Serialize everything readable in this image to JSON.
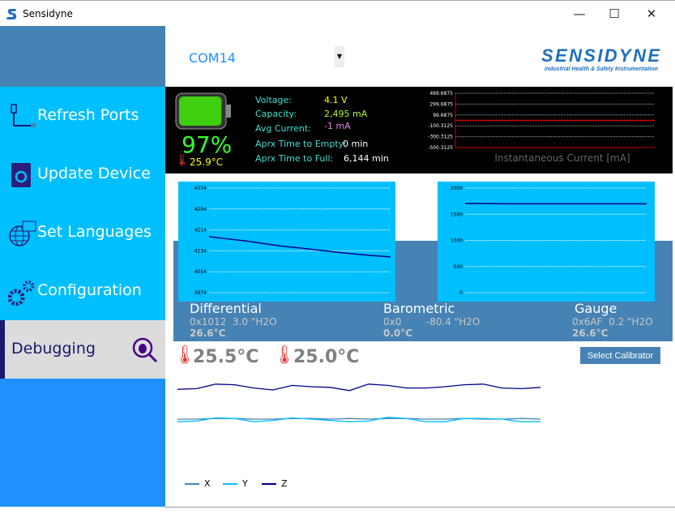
{
  "window": {
    "title": "Sensidyne",
    "minimize": "—",
    "maximize": "☐",
    "close": "✕"
  },
  "sidebar": {
    "items": [
      {
        "label": "Refresh Ports",
        "icon": "usb-cable-icon"
      },
      {
        "label": "Update Device",
        "icon": "update-device-icon"
      },
      {
        "label": "Set Languages",
        "icon": "globe-language-icon"
      },
      {
        "label": "Configuration",
        "icon": "gears-icon"
      },
      {
        "label": "Debugging",
        "icon": "bug-search-icon",
        "selected": true
      }
    ]
  },
  "header": {
    "port": "COM14",
    "logo_text": "SENSIDYNE",
    "logo_sub": "Industrial Health & Safety Instrumentation"
  },
  "battery": {
    "percent": "97%",
    "level": 0.97,
    "temp": "25.9°C",
    "labels": {
      "voltage": "Voltage:",
      "capacity": "Capacity:",
      "avg_current": "Avg Current:",
      "time_empty": "Aprx Time to Empty:",
      "time_full": "Aprx Time to Full:"
    },
    "values": {
      "voltage": "4.1 V",
      "capacity": "2,495 mA",
      "avg_current": "-1 mA",
      "time_empty": "0 min",
      "time_full": "6,144 min"
    }
  },
  "sensors": [
    {
      "name": "Differential",
      "raw": "0x1012",
      "value": "3.0 \"H2O",
      "temp": "26.6°C"
    },
    {
      "name": "Barometric",
      "raw": "0x0",
      "value": "-80.4 \"H2O",
      "temp": "0.0°C"
    },
    {
      "name": "Gauge",
      "raw": "0x6AF",
      "value": "0.2 \"H2O",
      "temp": "26.6°C"
    }
  ],
  "temps": [
    "25.5°C",
    "25.0°C"
  ],
  "buttons": {
    "select_calibrator": "Select Calibrator"
  },
  "colors": {
    "sidebar": "#00bfff",
    "selected": "#dcdcdc",
    "accent": "#4682b4",
    "chart_bg": "#00bfff",
    "line": "#00008b"
  },
  "chart_data": [
    {
      "type": "line",
      "title": "",
      "xlabel": "Instantaneous Current [mA]",
      "ylabel": "",
      "ylim": [
        -500.3125,
        499.6875
      ],
      "yticks": [
        "499.6875",
        "299.6875",
        "99.6875",
        "-100.3125",
        "-300.3125",
        "-500.3125"
      ],
      "grid": true,
      "series": [
        {
          "color": "#cc0000",
          "values": [
            -1,
            -1,
            -1,
            -1,
            -1,
            -1,
            -1,
            -1,
            -1,
            -1
          ]
        }
      ]
    },
    {
      "type": "line",
      "title": "",
      "ylim": [
        3974,
        4374
      ],
      "yticks": [
        "4374",
        "4294",
        "4214",
        "4134",
        "4054",
        "3974"
      ],
      "grid": true,
      "series": [
        {
          "color": "#00008b",
          "values": [
            4188,
            4180,
            4172,
            4162,
            4152,
            4145,
            4137,
            4129,
            4122,
            4116,
            4111
          ]
        }
      ]
    },
    {
      "type": "line",
      "title": "",
      "ylim": [
        0,
        2000
      ],
      "yticks": [
        "2000",
        "1500",
        "1000",
        "500",
        "0"
      ],
      "grid": true,
      "series": [
        {
          "color": "#00008b",
          "values": [
            1705,
            1705,
            1702,
            1700,
            1700,
            1700,
            1700,
            1700,
            1700,
            1700,
            1700
          ]
        }
      ]
    },
    {
      "type": "line",
      "title": "",
      "legend": "bottom-left",
      "grid": false,
      "series": [
        {
          "name": "X",
          "color": "#4682b4",
          "values": [
            2.0,
            2.0,
            2.1,
            2.1,
            2.0,
            2.0,
            2.1,
            2.1,
            2.0,
            2.1,
            2.0,
            2.1,
            2.1,
            2.0,
            2.0,
            2.1,
            2.0,
            2.0,
            2.1,
            2.0
          ]
        },
        {
          "name": "Y",
          "color": "#00bfff",
          "values": [
            1.6,
            1.7,
            2.2,
            2.1,
            1.6,
            1.8,
            2.2,
            2.0,
            1.8,
            1.6,
            1.7,
            2.3,
            2.1,
            1.6,
            1.6,
            2.1,
            2.1,
            2.0,
            1.6,
            1.6
          ]
        },
        {
          "name": "Z",
          "color": "#00008b",
          "values": [
            6.6,
            6.7,
            7.4,
            7.3,
            6.8,
            6.5,
            7.2,
            7.0,
            6.9,
            6.4,
            7.4,
            7.2,
            6.8,
            6.8,
            7.0,
            7.3,
            7.4,
            6.8,
            6.7,
            6.9
          ]
        }
      ]
    }
  ]
}
